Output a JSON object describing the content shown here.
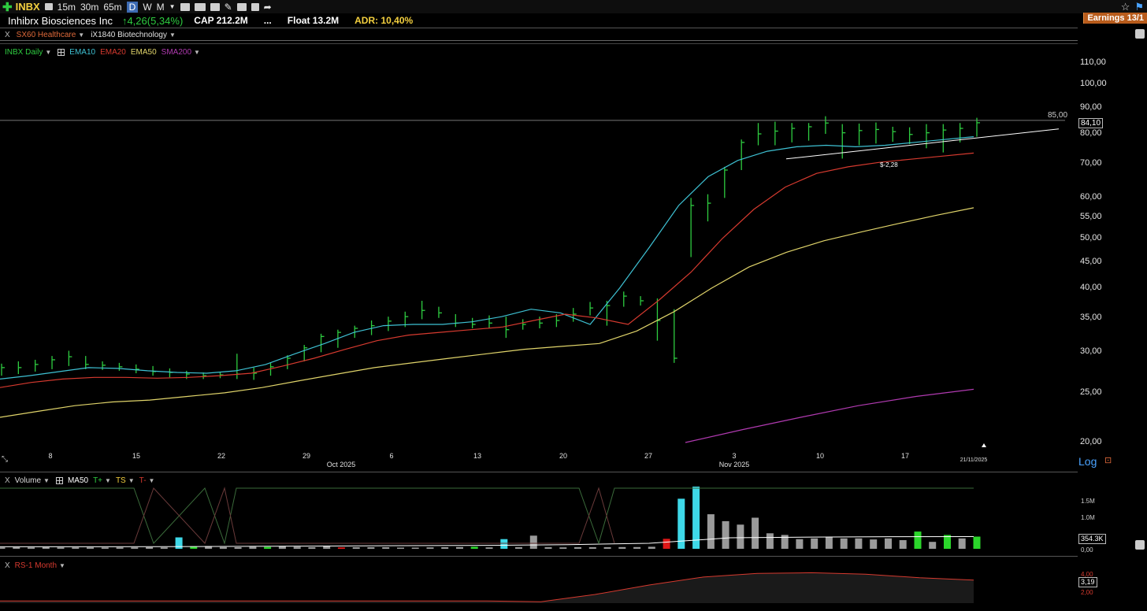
{
  "toolbar": {
    "ticker": "INBX",
    "timeframes": [
      "15m",
      "30m",
      "65m"
    ],
    "active_period": "D",
    "periods": [
      "W",
      "M"
    ]
  },
  "info": {
    "company": "Inhibrx Biosciences Inc",
    "change": "4,26(5,34%)",
    "cap": "CAP 212.2M",
    "dots": "...",
    "float": "Float 13.2M",
    "adr": "ADR: 10,40%",
    "earnings": "Earnings 13/1"
  },
  "tags": {
    "sector": "SX60 Healthcare",
    "industry": "iX1840 Biotechnology"
  },
  "price_panel": {
    "legend": [
      {
        "label": "INBX Daily",
        "color": "#2ecc40"
      },
      {
        "label": "EMA10",
        "color": "#3ec1d3"
      },
      {
        "label": "EMA20",
        "color": "#d63a2f"
      },
      {
        "label": "EMA50",
        "color": "#e0d46a"
      },
      {
        "label": "SMA200",
        "color": "#b03ab0"
      }
    ],
    "y_ticks": [
      "110,00",
      "100,00",
      "90,00",
      "80,00",
      "70,00",
      "60,00",
      "55,00",
      "50,00",
      "45,00",
      "40,00",
      "35,00",
      "30,00",
      "25,00",
      "20,00"
    ],
    "level_label": "85,00",
    "last_price": "84,10",
    "annotation": "$-2,28",
    "x_ticks": [
      "8",
      "15",
      "22",
      "29",
      "6",
      "13",
      "20",
      "27",
      "3",
      "10",
      "17"
    ],
    "month_labels": [
      "Oct 2025",
      "Nov 2025"
    ],
    "date_label": "21/11/2025",
    "scale_label": "Log"
  },
  "volume_panel": {
    "legend": [
      {
        "label": "Volume",
        "color": "#dddddd"
      },
      {
        "label": "MA50",
        "color": "#ffffff"
      },
      {
        "label": "T+",
        "color": "#2ecc40"
      },
      {
        "label": "TS",
        "color": "#f4d03f"
      },
      {
        "label": "T-",
        "color": "#d63a2f"
      }
    ],
    "y_ticks": [
      "1.5M",
      "1.0M",
      "0,00"
    ],
    "current": "354.3K"
  },
  "rs_panel": {
    "label": "RS-1 Month",
    "y_ticks": [
      "4,00",
      "2,00"
    ],
    "current": "3,19"
  },
  "chart_data": {
    "type": "ohlc",
    "title": "INBX Daily",
    "scale": "log",
    "ylim": [
      20,
      115
    ],
    "x_range": [
      "2025-09-02",
      "2025-11-21"
    ],
    "series_bars": [
      {
        "date": "2025-09-02",
        "low": 27.0,
        "high": 28.5,
        "close": 28.0
      },
      {
        "date": "2025-09-03",
        "low": 27.2,
        "high": 28.8,
        "close": 28.0
      },
      {
        "date": "2025-09-04",
        "low": 27.5,
        "high": 29.0,
        "close": 28.4
      },
      {
        "date": "2025-09-05",
        "low": 27.8,
        "high": 29.5,
        "close": 29.0
      },
      {
        "date": "2025-09-08",
        "low": 28.2,
        "high": 30.2,
        "close": 29.4
      },
      {
        "date": "2025-09-09",
        "low": 27.8,
        "high": 29.5,
        "close": 28.4
      },
      {
        "date": "2025-09-10",
        "low": 27.7,
        "high": 28.8,
        "close": 28.3
      },
      {
        "date": "2025-09-11",
        "low": 27.6,
        "high": 28.6,
        "close": 28.1
      },
      {
        "date": "2025-09-12",
        "low": 27.3,
        "high": 28.4,
        "close": 27.8
      },
      {
        "date": "2025-09-15",
        "low": 27.0,
        "high": 28.2,
        "close": 27.5
      },
      {
        "date": "2025-09-16",
        "low": 26.8,
        "high": 27.9,
        "close": 27.4
      },
      {
        "date": "2025-09-17",
        "low": 26.6,
        "high": 27.6,
        "close": 27.2
      },
      {
        "date": "2025-09-18",
        "low": 26.6,
        "high": 27.4,
        "close": 27.0
      },
      {
        "date": "2025-09-19",
        "low": 26.7,
        "high": 27.5,
        "close": 27.1
      },
      {
        "date": "2025-09-22",
        "low": 26.6,
        "high": 29.8,
        "close": 27.2
      },
      {
        "date": "2025-09-23",
        "low": 26.5,
        "high": 28.0,
        "close": 27.3
      },
      {
        "date": "2025-09-24",
        "low": 27.0,
        "high": 28.6,
        "close": 28.1
      },
      {
        "date": "2025-09-25",
        "low": 27.8,
        "high": 29.6,
        "close": 29.2
      },
      {
        "date": "2025-09-26",
        "low": 28.8,
        "high": 31.0,
        "close": 30.6
      },
      {
        "date": "2025-09-29",
        "low": 30.0,
        "high": 32.6,
        "close": 32.2
      },
      {
        "date": "2025-09-30",
        "low": 30.6,
        "high": 33.2,
        "close": 32.8
      },
      {
        "date": "2025-10-01",
        "low": 32.0,
        "high": 33.8,
        "close": 33.4
      },
      {
        "date": "2025-10-02",
        "low": 32.4,
        "high": 34.6,
        "close": 33.8
      },
      {
        "date": "2025-10-03",
        "low": 33.0,
        "high": 35.2,
        "close": 34.5
      },
      {
        "date": "2025-10-06",
        "low": 33.6,
        "high": 36.0,
        "close": 35.2
      },
      {
        "date": "2025-10-07",
        "low": 34.8,
        "high": 37.8,
        "close": 36.2
      },
      {
        "date": "2025-10-08",
        "low": 35.0,
        "high": 36.8,
        "close": 35.8
      },
      {
        "date": "2025-10-09",
        "low": 33.6,
        "high": 35.6,
        "close": 34.2
      },
      {
        "date": "2025-10-10",
        "low": 33.4,
        "high": 35.0,
        "close": 34.0
      },
      {
        "date": "2025-10-13",
        "low": 33.4,
        "high": 35.4,
        "close": 34.2
      },
      {
        "date": "2025-10-14",
        "low": 32.0,
        "high": 35.2,
        "close": 33.2
      },
      {
        "date": "2025-10-15",
        "low": 33.2,
        "high": 34.8,
        "close": 34.0
      },
      {
        "date": "2025-10-16",
        "low": 33.4,
        "high": 35.2,
        "close": 34.2
      },
      {
        "date": "2025-10-17",
        "low": 33.6,
        "high": 35.6,
        "close": 34.6
      },
      {
        "date": "2025-10-20",
        "low": 34.4,
        "high": 36.6,
        "close": 35.6
      },
      {
        "date": "2025-10-21",
        "low": 35.4,
        "high": 37.6,
        "close": 36.6
      },
      {
        "date": "2025-10-22",
        "low": 33.8,
        "high": 37.8,
        "close": 37.0
      },
      {
        "date": "2025-10-23",
        "low": 36.8,
        "high": 39.4,
        "close": 38.6
      },
      {
        "date": "2025-10-24",
        "low": 37.0,
        "high": 38.6,
        "close": 37.8
      },
      {
        "date": "2025-10-27",
        "low": 31.6,
        "high": 38.2,
        "close": 34.6
      },
      {
        "date": "2025-10-28",
        "low": 28.6,
        "high": 36.4,
        "close": 29.2
      },
      {
        "date": "2025-10-29",
        "low": 46.0,
        "high": 60.0,
        "close": 58.0
      },
      {
        "date": "2025-10-30",
        "low": 54.0,
        "high": 61.0,
        "close": 58.6
      },
      {
        "date": "2025-10-31",
        "low": 60.0,
        "high": 69.0,
        "close": 68.0
      },
      {
        "date": "2025-11-03",
        "low": 68.0,
        "high": 78.0,
        "close": 77.0
      },
      {
        "date": "2025-11-04",
        "low": 76.0,
        "high": 84.0,
        "close": 80.0
      },
      {
        "date": "2025-11-05",
        "low": 76.0,
        "high": 84.5,
        "close": 81.0
      },
      {
        "date": "2025-11-06",
        "low": 77.0,
        "high": 84.0,
        "close": 82.0
      },
      {
        "date": "2025-11-07",
        "low": 77.6,
        "high": 84.0,
        "close": 82.6
      },
      {
        "date": "2025-11-10",
        "low": 80.0,
        "high": 86.6,
        "close": 84.0
      },
      {
        "date": "2025-11-11",
        "low": 71.6,
        "high": 83.6,
        "close": 80.4
      },
      {
        "date": "2025-11-12",
        "low": 76.0,
        "high": 83.8,
        "close": 81.2
      },
      {
        "date": "2025-11-13",
        "low": 76.6,
        "high": 84.2,
        "close": 81.6
      },
      {
        "date": "2025-11-14",
        "low": 77.2,
        "high": 82.6,
        "close": 80.8
      },
      {
        "date": "2025-11-17",
        "low": 76.4,
        "high": 82.4,
        "close": 79.8
      },
      {
        "date": "2025-11-18",
        "low": 75.0,
        "high": 83.6,
        "close": 80.4
      },
      {
        "date": "2025-11-19",
        "low": 73.6,
        "high": 83.6,
        "close": 81.4
      },
      {
        "date": "2025-11-20",
        "low": 77.0,
        "high": 84.0,
        "close": 82.0
      },
      {
        "date": "2025-11-21",
        "low": 79.0,
        "high": 86.0,
        "close": 84.1
      }
    ],
    "ema10": [
      26.6,
      27.0,
      27.5,
      28.0,
      27.9,
      27.6,
      27.4,
      27.3,
      27.6,
      28.4,
      29.8,
      31.2,
      32.8,
      33.8,
      34.0,
      34.0,
      34.4,
      35.2,
      36.4,
      35.8,
      34.0,
      40.0,
      48.0,
      58.0,
      66.0,
      71.0,
      74.0,
      75.5,
      76.0,
      75.5,
      76.0,
      77.0,
      78.0,
      79.0
    ],
    "ema20": [
      25.6,
      26.2,
      26.6,
      26.8,
      26.8,
      26.7,
      26.8,
      27.0,
      27.3,
      28.2,
      29.2,
      30.4,
      31.6,
      32.4,
      32.8,
      33.2,
      33.6,
      34.6,
      35.6,
      35.0,
      34.0,
      38.0,
      43.0,
      50.0,
      57.0,
      63.0,
      67.0,
      69.0,
      70.4,
      71.4,
      72.4,
      73.4
    ],
    "ema50": [
      22.4,
      23.0,
      23.6,
      24.0,
      24.2,
      24.6,
      25.0,
      25.6,
      26.4,
      27.2,
      28.0,
      28.6,
      29.2,
      29.8,
      30.4,
      30.8,
      31.2,
      33.0,
      36.0,
      40.0,
      44.0,
      47.0,
      49.5,
      51.5,
      53.5,
      55.5,
      57.4
    ],
    "sma200": [
      20.0,
      21.2,
      22.4,
      23.6,
      24.6,
      25.4
    ],
    "volume": {
      "ylim": [
        0,
        1800000
      ],
      "values": [
        40000,
        45000,
        42000,
        45000,
        40000,
        42000,
        40000,
        38000,
        42000,
        40000,
        45000,
        40000,
        330000,
        60000,
        80000,
        50000,
        45000,
        60000,
        55000,
        70000,
        60000,
        45000,
        70000,
        40000,
        45000,
        45000,
        45000,
        35000,
        35000,
        40000,
        45000,
        50000,
        60000,
        40000,
        280000,
        45000,
        380000,
        45000,
        40000,
        45000,
        45000,
        45000,
        50000,
        50000,
        60000,
        290000,
        1450000,
        1800000,
        1000000,
        800000,
        700000,
        900000,
        450000,
        400000,
        280000,
        300000,
        330000,
        300000,
        300000,
        270000,
        300000,
        250000,
        500000,
        200000,
        400000,
        300000,
        354300
      ],
      "colors_note": "gray = normal, cyan = pocket pivot/high, green = up strong, red = down strong",
      "ma50": [
        60000,
        60000,
        62000,
        70000,
        80000,
        90000,
        100000,
        120000,
        160000,
        320000,
        340000,
        350000,
        354300
      ]
    },
    "rs_1_month": {
      "ylim": [
        0,
        5
      ],
      "values": [
        0.3,
        0.3,
        0.3,
        0.3,
        0.3,
        0.3,
        0.3,
        0.3,
        0.3,
        0.3,
        0.2,
        1.2,
        2.5,
        3.6,
        4.1,
        4.2,
        4.0,
        3.5,
        3.19
      ]
    }
  }
}
